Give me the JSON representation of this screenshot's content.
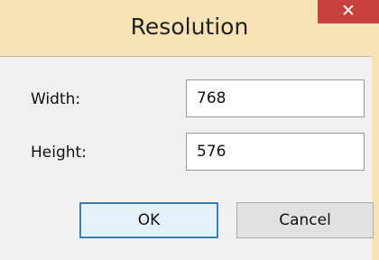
{
  "window": {
    "title": "Resolution",
    "close_glyph": "✕"
  },
  "form": {
    "width_label": "Width:",
    "width_value": "768",
    "height_label": "Height:",
    "height_value": "576"
  },
  "buttons": {
    "ok_label": "OK",
    "cancel_label": "Cancel"
  },
  "colors": {
    "title_bar": "#f7e3b6",
    "close_button": "#c7413f",
    "client_area": "#f0f0f0",
    "default_button_border": "#3c7fb1"
  },
  "icons": {
    "close": "close-icon"
  }
}
